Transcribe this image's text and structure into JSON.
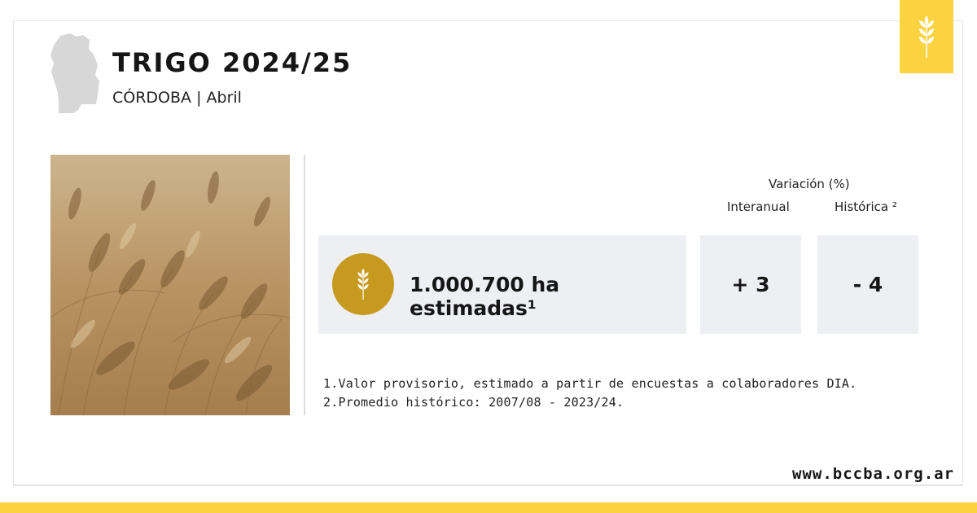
{
  "header": {
    "title": "TRIGO 2024/25",
    "subtitle": "CÓRDOBA | Abril"
  },
  "variation": {
    "heading": "Variación (%)",
    "col_interanual": "Interanual",
    "col_historica": "Histórica ²"
  },
  "metric": {
    "value": "1.000.700 ha estimadas¹",
    "interanual": "+ 3",
    "historica": "- 4"
  },
  "notes": [
    "1.Valor provisorio, estimado a partir de encuestas a colaboradores DIA.",
    "2.Promedio histórico: 2007/08 - 2023/24."
  ],
  "footer": {
    "website": "www.bccba.org.ar"
  },
  "icons": {
    "province": "cordoba-map-icon",
    "tab": "wheat-icon",
    "metric": "wheat-icon"
  },
  "colors": {
    "accent_yellow": "#fbd23f",
    "wheat_gold": "#c69a1f",
    "box_bg": "#eeeff3",
    "map_gray": "#d7d7d7"
  }
}
